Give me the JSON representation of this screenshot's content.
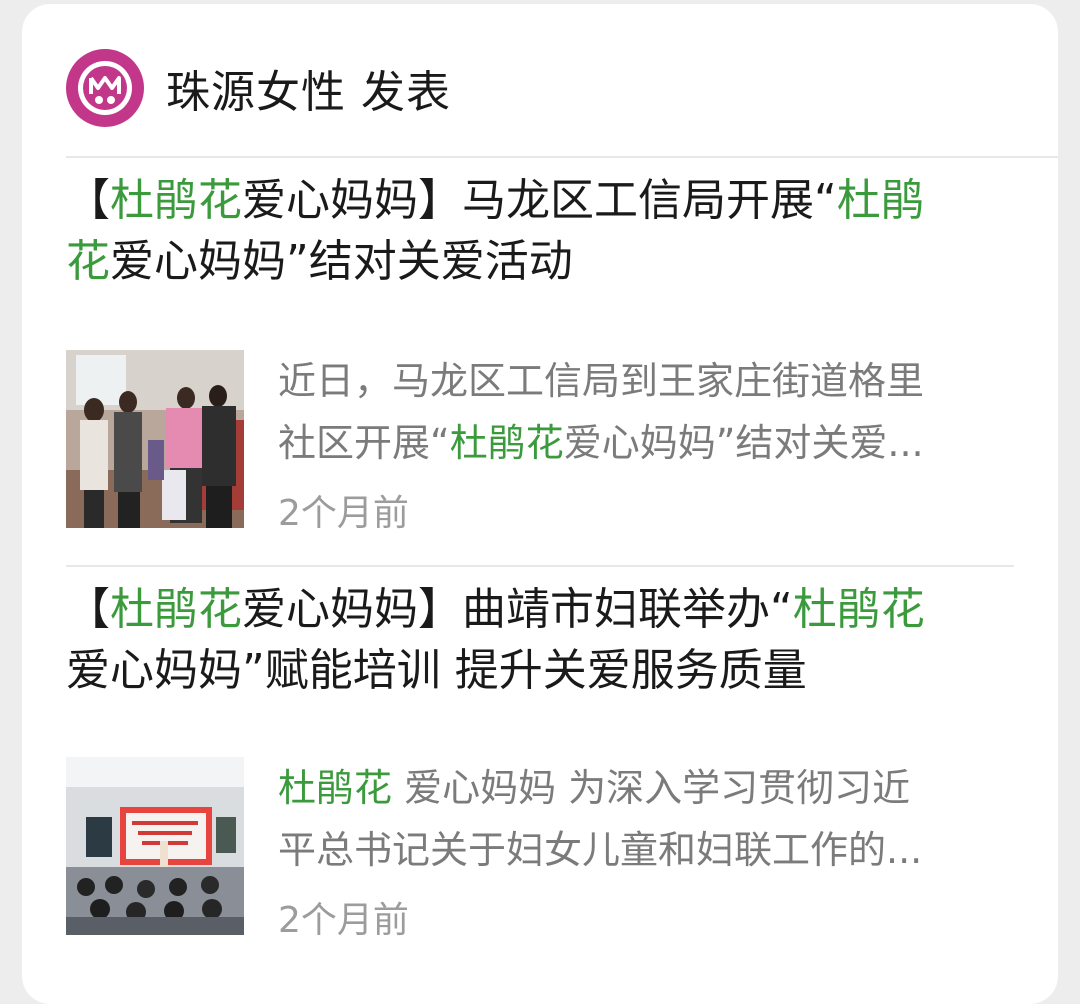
{
  "header": {
    "title": "珠源女性 发表"
  },
  "articles": [
    {
      "title_parts": [
        "【",
        "杜鹃花",
        "爱心妈妈】马龙区工信局开展“",
        "杜鹃",
        "花",
        "爱心妈妈”结对关爱活动"
      ],
      "summary_parts": [
        "近日，马龙区工信局到王家庄街道格里",
        "社区开展“",
        "杜鹃花",
        "爱心妈妈”结对关爱..."
      ],
      "time": "2个月前",
      "thumbnail": "photo-people-visit"
    },
    {
      "title_parts": [
        "【",
        "杜鹃花",
        "爱心妈妈】曲靖市妇联举办“",
        "杜鹃花",
        "爱心妈妈”赋能培训 提升关爱服务质量"
      ],
      "summary_parts": [
        "杜鹃花",
        " 爱心妈妈 为深入学习贯彻习近",
        "平总书记关于妇女儿童和妇联工作的..."
      ],
      "time": "2个月前",
      "thumbnail": "photo-training-hall"
    }
  ],
  "colors": {
    "highlight": "#3a9a3c",
    "logo": "#c2378a",
    "summary": "#7b7b7b",
    "time": "#9c9c9c"
  }
}
